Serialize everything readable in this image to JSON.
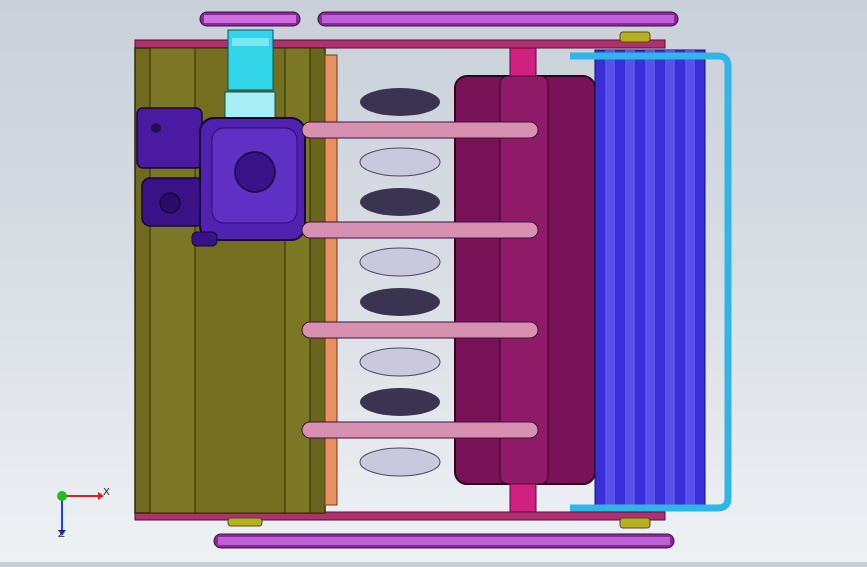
{
  "viewport": {
    "background_top": "#c9d0d9",
    "background_bottom": "#eef1f4"
  },
  "model": {
    "frame_color": "#6f6a1e",
    "engine_color": "#4a1aa0",
    "pulley_color": "#33d6e8",
    "disc_color": "#c9c8dc",
    "hopper_color": "#7a1258",
    "roller_color": "#3a2fd6",
    "pipe_color": "#2fb5e6",
    "chain_color": "#b020c0",
    "rail_color": "#a0206a"
  },
  "triad": {
    "x_label": "X",
    "z_label": "Z",
    "x_color": "#e02020",
    "y_color": "#20c020",
    "z_color": "#2040e0"
  }
}
